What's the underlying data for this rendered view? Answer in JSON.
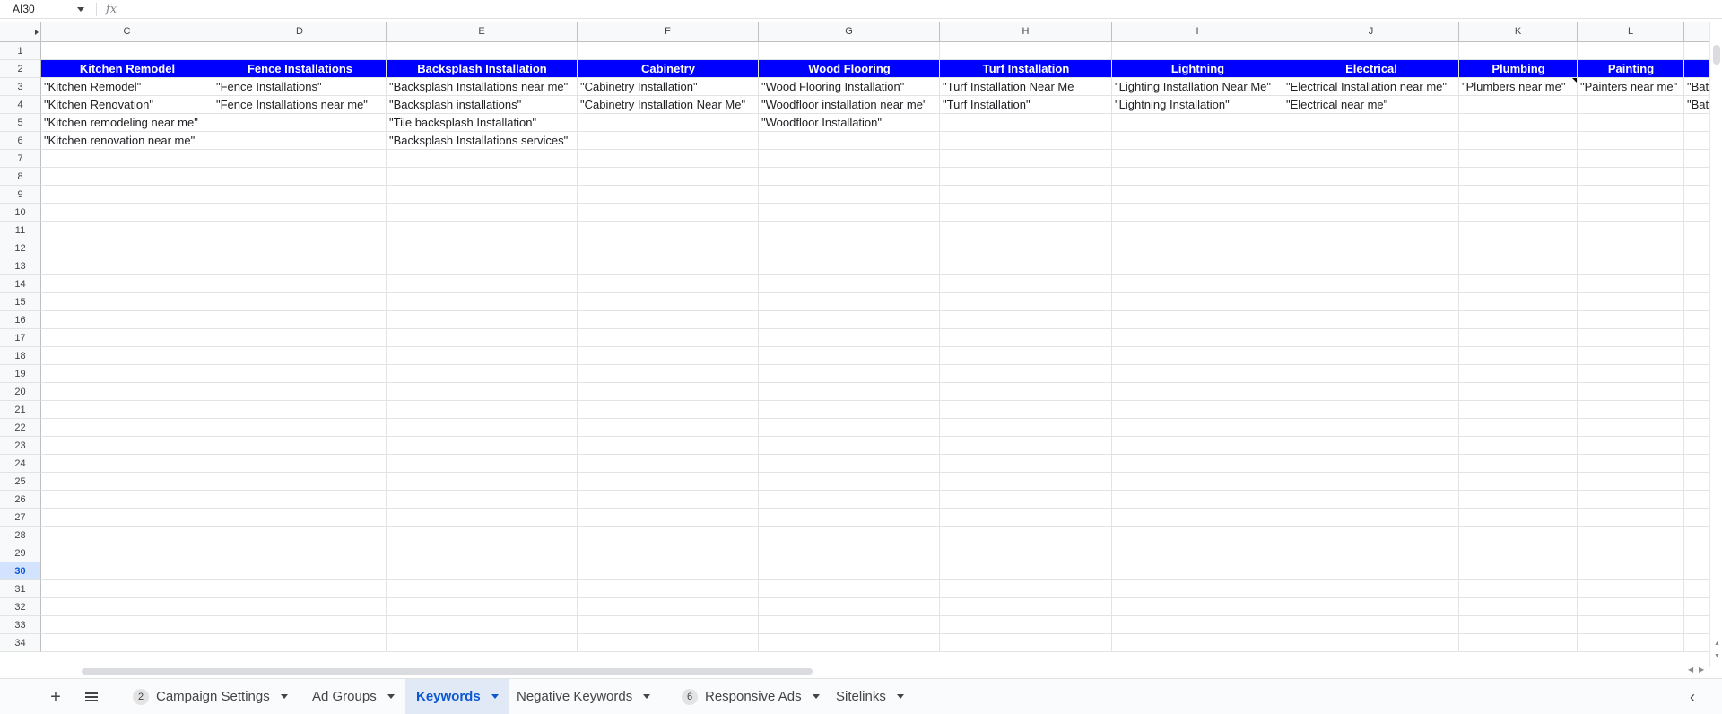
{
  "formula_bar": {
    "name_box": "AI30",
    "fx_label": "fx"
  },
  "columns": [
    {
      "letter": "C",
      "header": "Kitchen Remodel",
      "cells": [
        "\"Kitchen Remodel\"",
        "\"Kitchen Renovation\"",
        "\"Kitchen remodeling near me\"",
        "\"Kitchen renovation near me\""
      ]
    },
    {
      "letter": "D",
      "header": "Fence Installations",
      "cells": [
        "\"Fence Installations\"",
        "\"Fence Installations near me\""
      ]
    },
    {
      "letter": "E",
      "header": "Backsplash Installation",
      "cells": [
        "\"Backsplash Installations near me\"",
        "\"Backsplash installations\"",
        "\"Tile backsplash Installation\"",
        "\"Backsplash Installations services\""
      ]
    },
    {
      "letter": "F",
      "header": "Cabinetry",
      "cells": [
        "\"Cabinetry Installation\"",
        "\"Cabinetry Installation Near Me\""
      ]
    },
    {
      "letter": "G",
      "header": "Wood Flooring",
      "cells": [
        "\"Wood Flooring Installation\"",
        "\"Woodfloor installation near me\"",
        "\"Woodfloor Installation\""
      ]
    },
    {
      "letter": "H",
      "header": "Turf Installation",
      "cells": [
        "\"Turf Installation Near Me",
        "\"Turf Installation\""
      ]
    },
    {
      "letter": "I",
      "header": "Lightning",
      "cells": [
        "\"Lighting Installation Near Me\"",
        "\"Lightning Installation\""
      ]
    },
    {
      "letter": "J",
      "header": "Electrical",
      "cells": [
        "\"Electrical Installation near me\"",
        "\"Electrical near me\""
      ]
    },
    {
      "letter": "K",
      "header": "Plumbing",
      "cells": [
        "\"Plumbers near me\""
      ]
    },
    {
      "letter": "L",
      "header": "Painting",
      "cells": [
        "\"Painters near me\""
      ]
    },
    {
      "letter": "",
      "header": "",
      "cells": [
        "\"Bat",
        "\"Bat"
      ]
    }
  ],
  "rows": [
    "1",
    "2",
    "3",
    "4",
    "5",
    "6",
    "7",
    "8",
    "9",
    "10",
    "11",
    "12",
    "13",
    "14",
    "15",
    "16",
    "17",
    "18",
    "19",
    "20",
    "21",
    "22",
    "23",
    "24",
    "25",
    "26",
    "27",
    "28",
    "29",
    "30",
    "31",
    "32",
    "33",
    "34"
  ],
  "selected_row": "30",
  "header_band_color": "#0000ff",
  "tabs": [
    {
      "label": "Campaign Settings",
      "badge": "2"
    },
    {
      "label": "Ad Groups",
      "badge": ""
    },
    {
      "label": "Keywords",
      "badge": "",
      "active": true
    },
    {
      "label": "Negative Keywords",
      "badge": ""
    },
    {
      "label": "Responsive Ads",
      "badge": "6"
    },
    {
      "label": "Sitelinks",
      "badge": ""
    }
  ]
}
